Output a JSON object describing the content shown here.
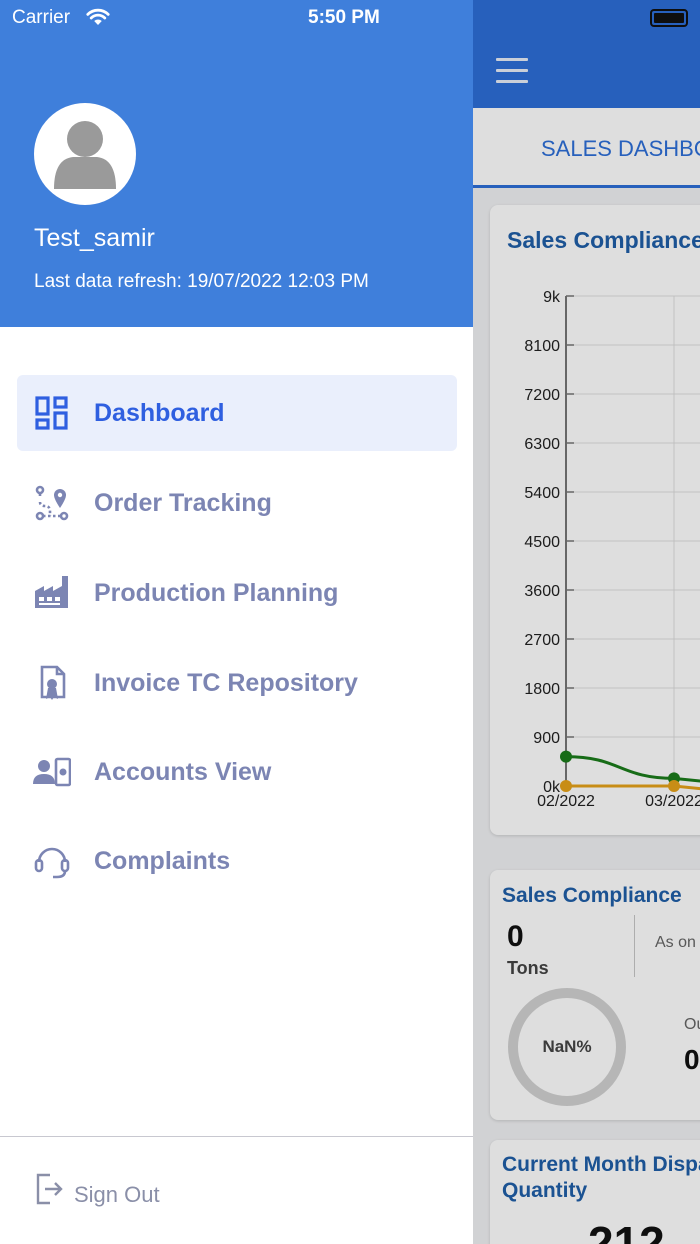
{
  "status_bar": {
    "carrier": "Carrier",
    "time": "5:50 PM"
  },
  "profile": {
    "username": "Test_samir",
    "last_refresh": "Last data refresh: 19/07/2022 12:03 PM"
  },
  "nav": {
    "items": [
      {
        "label": "Dashboard",
        "icon": "dashboard-icon",
        "active": true
      },
      {
        "label": "Order Tracking",
        "icon": "route-pin-icon",
        "active": false
      },
      {
        "label": "Production Planning",
        "icon": "factory-icon",
        "active": false
      },
      {
        "label": "Invoice TC Repository",
        "icon": "certificate-icon",
        "active": false
      },
      {
        "label": "Accounts View",
        "icon": "user-card-icon",
        "active": false
      },
      {
        "label": "Complaints",
        "icon": "headset-icon",
        "active": false
      }
    ]
  },
  "sign_out": {
    "label": "Sign Out",
    "icon": "sign-out-icon"
  },
  "background": {
    "tab_label": "SALES DASHBO",
    "chart_card_title": "Sales Compliance",
    "compliance_card": {
      "title": "Sales Compliance",
      "value": "0",
      "unit": "Tons",
      "as_of": "As on",
      "ring_label": "NaN%",
      "out_label": "Ou",
      "out_value": "0"
    },
    "dispatch_card": {
      "title_line1": "Current Month Dispa",
      "title_line2": "Quantity",
      "value": "212"
    }
  },
  "chart_data": {
    "type": "line",
    "title": "Sales Compliance",
    "x": [
      "02/2022",
      "03/2022"
    ],
    "y_ticks": [
      "0k",
      "900",
      "1800",
      "2700",
      "3600",
      "4500",
      "5400",
      "6300",
      "7200",
      "8100",
      "9k"
    ],
    "ylim": [
      0,
      9000
    ],
    "grid": true,
    "series": [
      {
        "color": "#1b7d1b",
        "values": [
          540,
          140
        ]
      },
      {
        "color": "#e6a21a",
        "values": [
          0,
          0
        ]
      }
    ]
  },
  "colors": {
    "header_blue": "#3f7fdb",
    "active_nav_text": "#2f5fe0",
    "inactive_nav_text": "#7c85b3",
    "active_nav_bg": "#eaeffc"
  }
}
